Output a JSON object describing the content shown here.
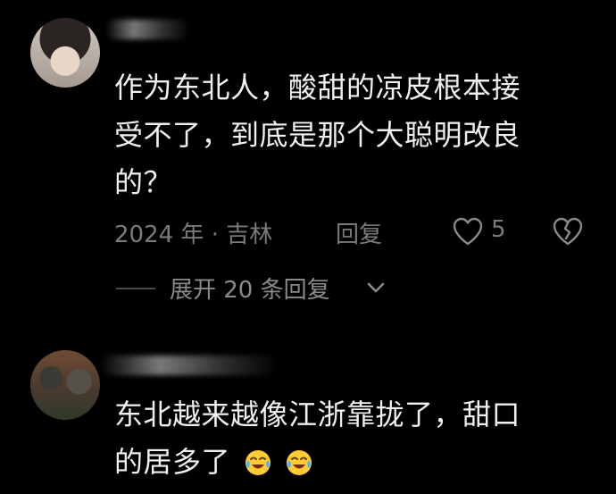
{
  "comments": [
    {
      "text_lines": [
        "作为东北人，酸甜的凉皮根本接",
        "受不了，到底是那个大聪明改良",
        "的？"
      ],
      "date_location": "2024 年 · 吉林",
      "reply_label": "回复",
      "like_count": "5",
      "expand_label": "展开 20 条回复"
    },
    {
      "text_lines": [
        "东北越来越像江浙靠拢了，甜口",
        "的居多了"
      ],
      "emojis": [
        "crying-laughing-emoji",
        "crying-laughing-emoji"
      ]
    }
  ],
  "colors": {
    "background": "#000000",
    "text": "#f0f0f0",
    "meta": "#7a7a7a"
  }
}
